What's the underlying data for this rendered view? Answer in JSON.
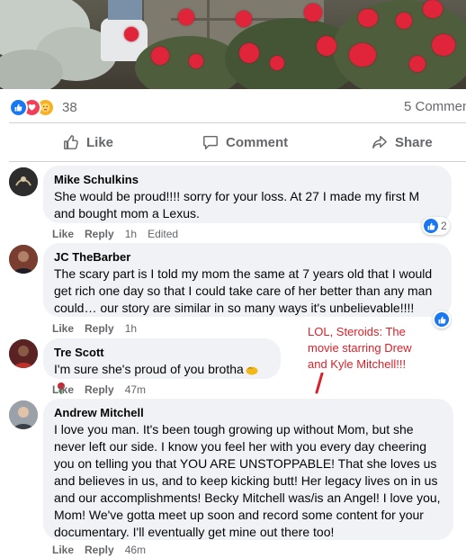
{
  "post": {
    "reaction_icons": [
      "like-icon",
      "love-icon",
      "care-icon"
    ],
    "reaction_count": "38",
    "comment_count": "5 Commen"
  },
  "actions": {
    "like": "Like",
    "comment": "Comment",
    "share": "Share"
  },
  "comments": [
    {
      "name": "Mike Schulkins",
      "text": "She would be proud!!!! sorry for your loss. At 27 I made my first M and bought mom a Lexus.",
      "like": "Like",
      "reply": "Reply",
      "time": "1h",
      "edited": "Edited",
      "reaction_count": "2"
    },
    {
      "name": "JC TheBarber",
      "text": "The scary part is I told my mom the same at 7 years old that I would get rich one day so that I could take care of her better than any man could… our story are similar in so many ways it's unbelievable!!!!",
      "like": "Like",
      "reply": "Reply",
      "time": "1h"
    },
    {
      "name": "Tre Scott",
      "text": "I'm sure she's proud of you brotha",
      "like": "Like",
      "reply": "Reply",
      "time": "47m"
    },
    {
      "name": "Andrew Mitchell",
      "text": "I love you man. It's been tough growing up without Mom, but she never left our side. I know you feel her with you every day cheering you on telling you that YOU ARE UNSTOPPABLE! That she loves us and believes in us, and to keep kicking butt! Her legacy lives on in us and our accomplishments! Becky Mitchell was/is an Angel! I love you, Mom! We've gotta meet up soon and record some content for your documentary. I'll eventually get mine out there too!",
      "like": "Like",
      "reply": "Reply",
      "time": "46m"
    }
  ],
  "annotation": {
    "lines": [
      "LOL, Steroids: The",
      "movie starring Drew",
      "and Kyle Mitchell!!!"
    ],
    "color": "#d8222a"
  },
  "colors": {
    "accent": "#1877f2",
    "bubble": "#f0f2f5",
    "muted": "#65676b"
  }
}
